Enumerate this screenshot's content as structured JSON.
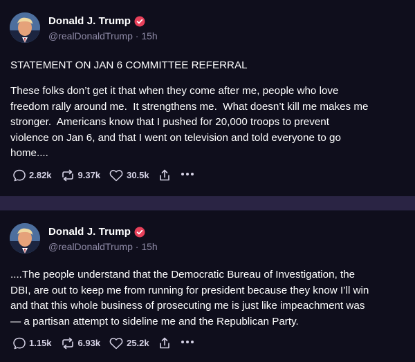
{
  "posts": [
    {
      "author": {
        "display_name": "Donald J. Trump",
        "handle": "@realDonaldTrump",
        "time": "15h"
      },
      "title": "STATEMENT ON JAN 6 COMMITTEE REFERRAL",
      "text": "These folks don’t get it that when they come after me, people who love\nfreedom rally around me.  It strengthens me.  What doesn’t kill me makes me\nstronger.  Americans know that I pushed for 20,000 troops to prevent\nviolence on Jan 6, and that I went on television and told everyone to go\nhome....",
      "stats": {
        "replies": "2.82k",
        "retruths": "9.37k",
        "likes": "30.5k"
      }
    },
    {
      "author": {
        "display_name": "Donald J. Trump",
        "handle": "@realDonaldTrump",
        "time": "15h"
      },
      "text": "....The people understand that the Democratic Bureau of Investigation, the\nDBI, are out to keep me from running for president because they know I’ll win\nand that this whole business of prosecuting me is just like impeachment was\n— a partisan attempt to sideline me and the Republican Party.",
      "stats": {
        "replies": "1.15k",
        "retruths": "6.93k",
        "likes": "25.2k"
      }
    }
  ],
  "separator": "·",
  "colors": {
    "background": "#0f0e1c",
    "divider": "#2a2444",
    "verified_badge": "#e8405a",
    "muted_text": "#8e8aa6"
  },
  "icons": {
    "reply": "speech-bubble-icon",
    "retruth": "repost-arrows-icon",
    "like": "heart-icon",
    "share": "share-upload-icon",
    "more": "more-dots-icon",
    "verified": "verified-badge-icon"
  }
}
